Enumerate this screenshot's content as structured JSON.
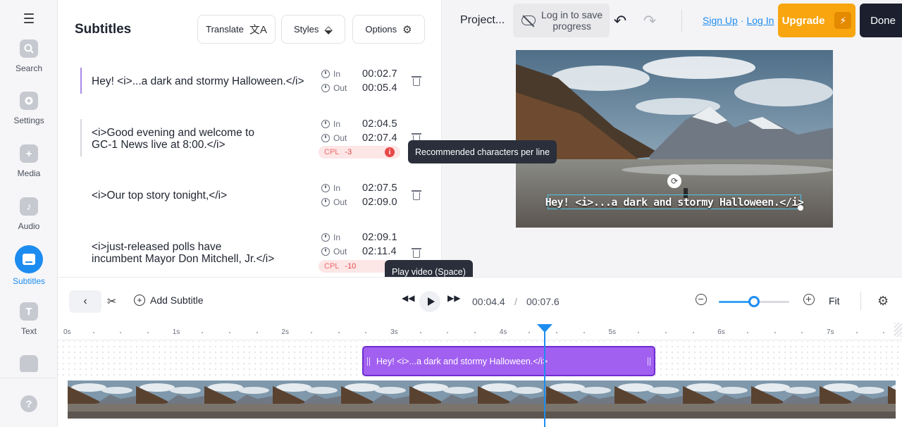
{
  "rail": {
    "items": [
      {
        "label": "Search"
      },
      {
        "label": "Settings"
      },
      {
        "label": "Media"
      },
      {
        "label": "Audio"
      },
      {
        "label": "Subtitles"
      },
      {
        "label": "Text"
      }
    ],
    "help_label": "?"
  },
  "panel": {
    "title": "Subtitles",
    "translate_label": "Translate",
    "styles_label": "Styles",
    "options_label": "Options"
  },
  "subtitles": [
    {
      "line1": "Hey! <i>...a dark and stormy Halloween.</i>",
      "line2": "",
      "in_label": "In",
      "in": "00:02.7",
      "out_label": "Out",
      "out": "00:05.4",
      "cpl": null
    },
    {
      "line1": "<i>Good evening and welcome to",
      "line2": "GC-1 News live at 8:00.</i>",
      "in_label": "In",
      "in": "02:04.5",
      "out_label": "Out",
      "out": "02:07.4",
      "cpl": {
        "label": "CPL",
        "value": "-3"
      }
    },
    {
      "line1": "<i>Our top story tonight,</i>",
      "line2": "",
      "in_label": "In",
      "in": "02:07.5",
      "out_label": "Out",
      "out": "02:09.0",
      "cpl": null
    },
    {
      "line1": "<i>just-released polls have",
      "line2": "incumbent Mayor Don Mitchell, Jr.</i>",
      "in_label": "In",
      "in": "02:09.1",
      "out_label": "Out",
      "out": "02:11.4",
      "cpl": {
        "label": "CPL",
        "value": "-10"
      }
    }
  ],
  "tooltips": {
    "cpl": "Recommended characters per line",
    "play": "Play video (Space)"
  },
  "topbar": {
    "project": "Project...",
    "save_line1": "Log in to save",
    "save_line2": "progress",
    "signup": "Sign Up",
    "sep": "·",
    "login": "Log In",
    "upgrade": "Upgrade",
    "done": "Done"
  },
  "preview": {
    "subtitle_overlay": "Hey! <i>...a dark and stormy Halloween.</i>"
  },
  "timeline": {
    "add_subtitle": "Add Subtitle",
    "current_time": "00:04.4",
    "time_separator": "/",
    "total_time": "00:07.6",
    "fit_label": "Fit",
    "zoom_level": 0.5,
    "ruler_ticks": [
      "0s",
      "1s",
      "2s",
      "3s",
      "4s",
      "5s",
      "6s",
      "7s"
    ],
    "clip_text": "Hey! <i>...a dark and stormy Halloween.</i>",
    "playhead_time_s": 4.4
  },
  "colors": {
    "accent": "#1d8cf0",
    "upgrade": "#f8a50f",
    "done": "#1b1f2e",
    "clip": "#a260f0",
    "cpl_warning": "#e84848"
  }
}
